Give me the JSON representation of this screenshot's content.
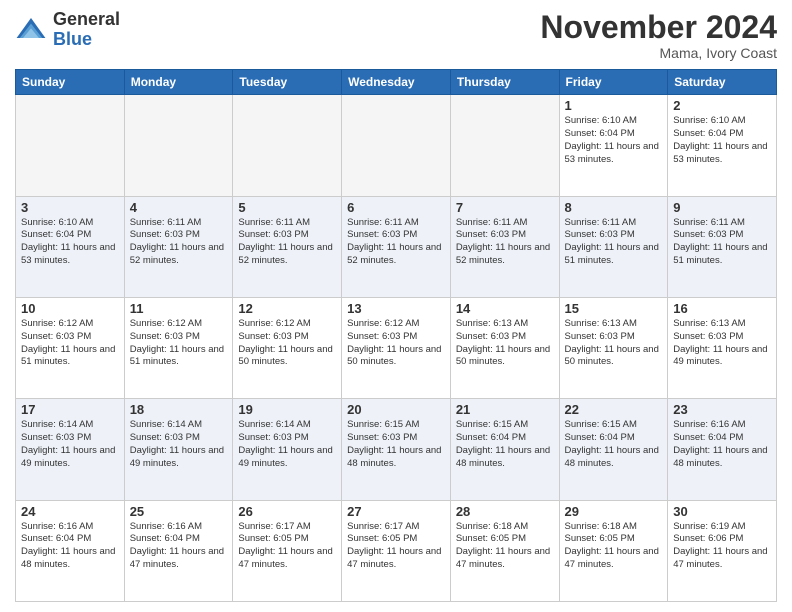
{
  "logo": {
    "general": "General",
    "blue": "Blue"
  },
  "header": {
    "month": "November 2024",
    "location": "Mama, Ivory Coast"
  },
  "weekdays": [
    "Sunday",
    "Monday",
    "Tuesday",
    "Wednesday",
    "Thursday",
    "Friday",
    "Saturday"
  ],
  "weeks": [
    [
      {
        "day": "",
        "empty": true
      },
      {
        "day": "",
        "empty": true
      },
      {
        "day": "",
        "empty": true
      },
      {
        "day": "",
        "empty": true
      },
      {
        "day": "",
        "empty": true
      },
      {
        "day": "1",
        "sunrise": "6:10 AM",
        "sunset": "6:04 PM",
        "daylight": "11 hours and 53 minutes."
      },
      {
        "day": "2",
        "sunrise": "6:10 AM",
        "sunset": "6:04 PM",
        "daylight": "11 hours and 53 minutes."
      }
    ],
    [
      {
        "day": "3",
        "sunrise": "6:10 AM",
        "sunset": "6:04 PM",
        "daylight": "11 hours and 53 minutes."
      },
      {
        "day": "4",
        "sunrise": "6:11 AM",
        "sunset": "6:03 PM",
        "daylight": "11 hours and 52 minutes."
      },
      {
        "day": "5",
        "sunrise": "6:11 AM",
        "sunset": "6:03 PM",
        "daylight": "11 hours and 52 minutes."
      },
      {
        "day": "6",
        "sunrise": "6:11 AM",
        "sunset": "6:03 PM",
        "daylight": "11 hours and 52 minutes."
      },
      {
        "day": "7",
        "sunrise": "6:11 AM",
        "sunset": "6:03 PM",
        "daylight": "11 hours and 52 minutes."
      },
      {
        "day": "8",
        "sunrise": "6:11 AM",
        "sunset": "6:03 PM",
        "daylight": "11 hours and 51 minutes."
      },
      {
        "day": "9",
        "sunrise": "6:11 AM",
        "sunset": "6:03 PM",
        "daylight": "11 hours and 51 minutes."
      }
    ],
    [
      {
        "day": "10",
        "sunrise": "6:12 AM",
        "sunset": "6:03 PM",
        "daylight": "11 hours and 51 minutes."
      },
      {
        "day": "11",
        "sunrise": "6:12 AM",
        "sunset": "6:03 PM",
        "daylight": "11 hours and 51 minutes."
      },
      {
        "day": "12",
        "sunrise": "6:12 AM",
        "sunset": "6:03 PM",
        "daylight": "11 hours and 50 minutes."
      },
      {
        "day": "13",
        "sunrise": "6:12 AM",
        "sunset": "6:03 PM",
        "daylight": "11 hours and 50 minutes."
      },
      {
        "day": "14",
        "sunrise": "6:13 AM",
        "sunset": "6:03 PM",
        "daylight": "11 hours and 50 minutes."
      },
      {
        "day": "15",
        "sunrise": "6:13 AM",
        "sunset": "6:03 PM",
        "daylight": "11 hours and 50 minutes."
      },
      {
        "day": "16",
        "sunrise": "6:13 AM",
        "sunset": "6:03 PM",
        "daylight": "11 hours and 49 minutes."
      }
    ],
    [
      {
        "day": "17",
        "sunrise": "6:14 AM",
        "sunset": "6:03 PM",
        "daylight": "11 hours and 49 minutes."
      },
      {
        "day": "18",
        "sunrise": "6:14 AM",
        "sunset": "6:03 PM",
        "daylight": "11 hours and 49 minutes."
      },
      {
        "day": "19",
        "sunrise": "6:14 AM",
        "sunset": "6:03 PM",
        "daylight": "11 hours and 49 minutes."
      },
      {
        "day": "20",
        "sunrise": "6:15 AM",
        "sunset": "6:03 PM",
        "daylight": "11 hours and 48 minutes."
      },
      {
        "day": "21",
        "sunrise": "6:15 AM",
        "sunset": "6:04 PM",
        "daylight": "11 hours and 48 minutes."
      },
      {
        "day": "22",
        "sunrise": "6:15 AM",
        "sunset": "6:04 PM",
        "daylight": "11 hours and 48 minutes."
      },
      {
        "day": "23",
        "sunrise": "6:16 AM",
        "sunset": "6:04 PM",
        "daylight": "11 hours and 48 minutes."
      }
    ],
    [
      {
        "day": "24",
        "sunrise": "6:16 AM",
        "sunset": "6:04 PM",
        "daylight": "11 hours and 48 minutes."
      },
      {
        "day": "25",
        "sunrise": "6:16 AM",
        "sunset": "6:04 PM",
        "daylight": "11 hours and 47 minutes."
      },
      {
        "day": "26",
        "sunrise": "6:17 AM",
        "sunset": "6:05 PM",
        "daylight": "11 hours and 47 minutes."
      },
      {
        "day": "27",
        "sunrise": "6:17 AM",
        "sunset": "6:05 PM",
        "daylight": "11 hours and 47 minutes."
      },
      {
        "day": "28",
        "sunrise": "6:18 AM",
        "sunset": "6:05 PM",
        "daylight": "11 hours and 47 minutes."
      },
      {
        "day": "29",
        "sunrise": "6:18 AM",
        "sunset": "6:05 PM",
        "daylight": "11 hours and 47 minutes."
      },
      {
        "day": "30",
        "sunrise": "6:19 AM",
        "sunset": "6:06 PM",
        "daylight": "11 hours and 47 minutes."
      }
    ]
  ]
}
